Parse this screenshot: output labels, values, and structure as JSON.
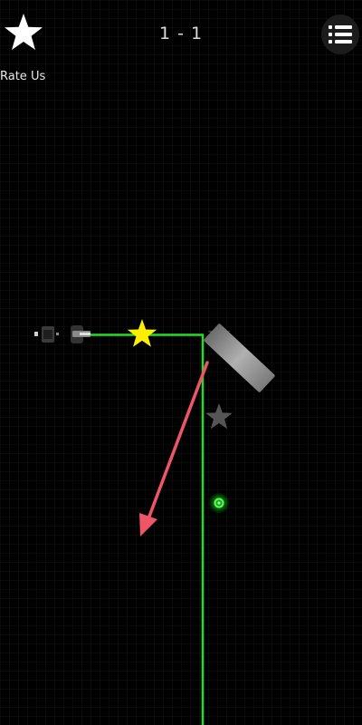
{
  "header": {
    "rate_label": "Rate Us",
    "level_label": "1 - 1"
  },
  "icons": {
    "rate": "star-icon",
    "menu": "list-menu-icon"
  },
  "colors": {
    "background": "#000000",
    "laser": "#22dd22",
    "collected_star": "#ffee00",
    "uncollected_star": "#555555",
    "hint_arrow": "#ee5566",
    "mirror": "#9a9a9a",
    "target": "#33ff33"
  },
  "game": {
    "stars_total": 2,
    "stars_lit": 1
  }
}
